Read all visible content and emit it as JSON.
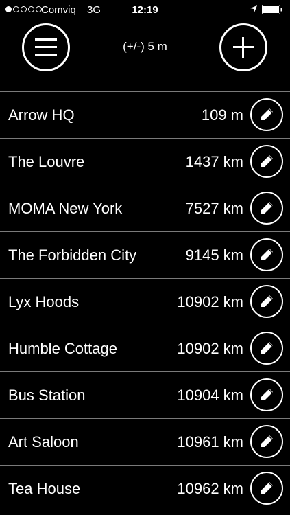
{
  "status_bar": {
    "carrier": "Comviq",
    "network": "3G",
    "time": "12:19",
    "signal_bars_filled": 1,
    "signal_bars_total": 5,
    "battery_level": 1.0
  },
  "header": {
    "accuracy_text": "(+/-) 5 m",
    "menu_icon": "hamburger-icon",
    "add_icon": "plus-icon"
  },
  "places": [
    {
      "name": "Arrow HQ",
      "distance": "109 m"
    },
    {
      "name": "The Louvre",
      "distance": "1437 km"
    },
    {
      "name": "MOMA New York",
      "distance": "7527 km"
    },
    {
      "name": "The Forbidden City",
      "distance": "9145 km"
    },
    {
      "name": "Lyx Hoods",
      "distance": "10902 km"
    },
    {
      "name": "Humble Cottage",
      "distance": "10902 km"
    },
    {
      "name": "Bus Station",
      "distance": "10904 km"
    },
    {
      "name": "Art Saloon",
      "distance": "10961 km"
    },
    {
      "name": "Tea House",
      "distance": "10962 km"
    }
  ],
  "colors": {
    "background": "#000000",
    "foreground": "#ffffff",
    "divider": "#7a7a7a"
  }
}
